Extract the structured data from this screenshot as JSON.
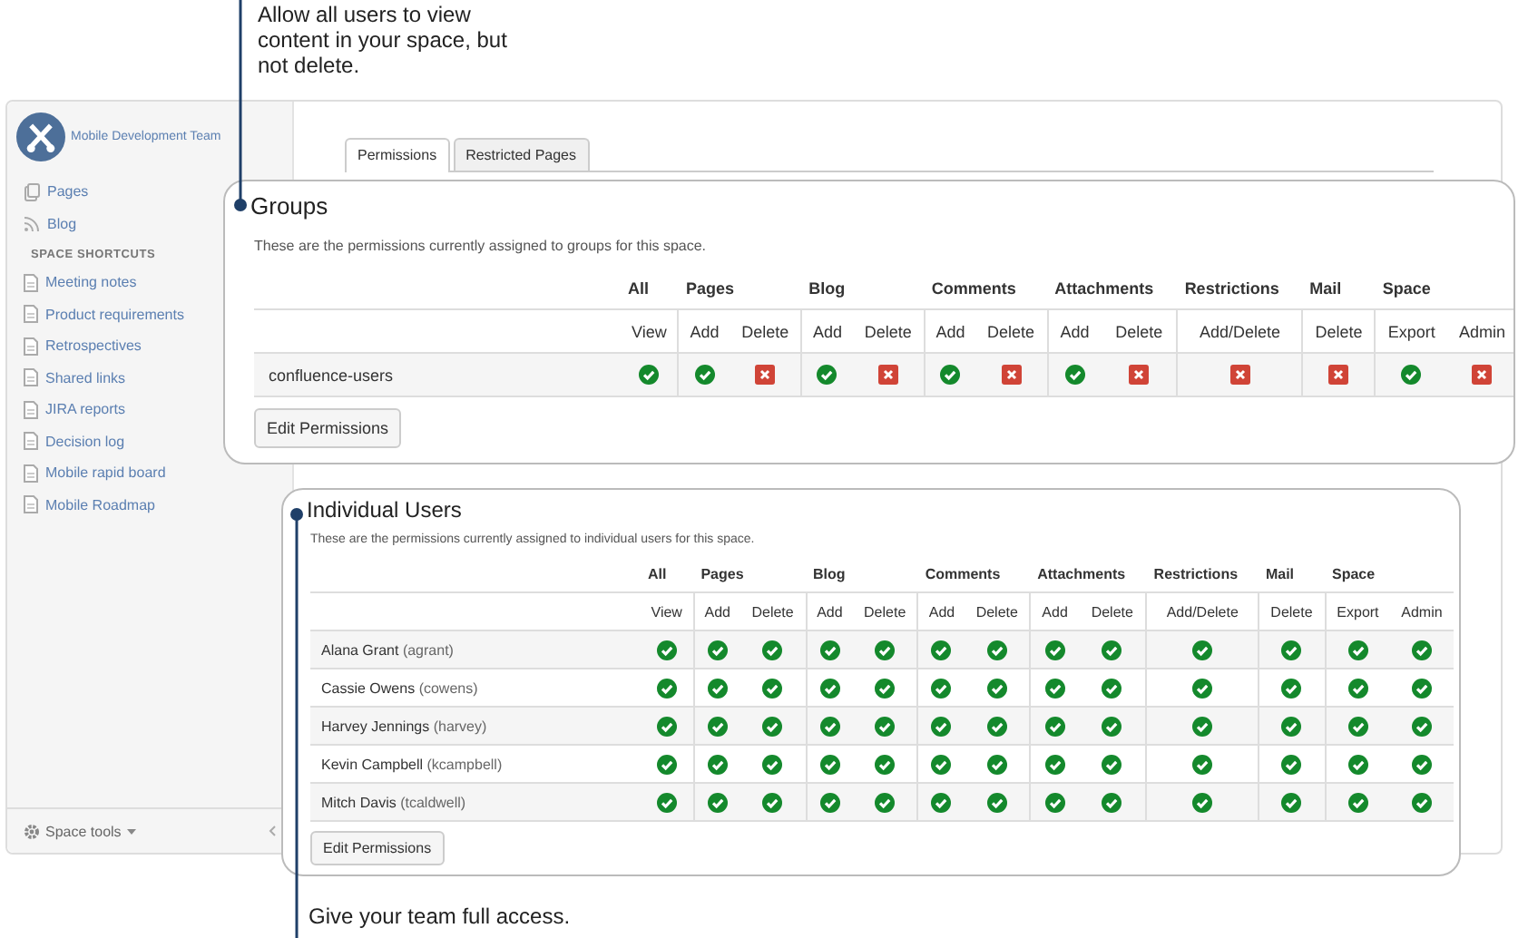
{
  "annotations": [
    {
      "text": "Allow all users to view content in your space, but not delete."
    },
    {
      "text": "Give your team full access."
    }
  ],
  "sidebar": {
    "space_name": "Mobile Development Team",
    "items": [
      {
        "label": "Pages",
        "kind": "pages"
      },
      {
        "label": "Blog",
        "kind": "blog"
      }
    ],
    "shortcuts_heading": "SPACE SHORTCUTS",
    "shortcuts": [
      {
        "label": "Meeting notes"
      },
      {
        "label": "Product requirements"
      },
      {
        "label": "Retrospectives"
      },
      {
        "label": "Shared links"
      },
      {
        "label": "JIRA reports"
      },
      {
        "label": "Decision log"
      },
      {
        "label": "Mobile rapid board"
      },
      {
        "label": "Mobile Roadmap"
      }
    ],
    "footer": "Space tools"
  },
  "tabs": [
    {
      "label": "Permissions",
      "selected": true
    },
    {
      "label": "Restricted Pages",
      "selected": false
    }
  ],
  "groups": {
    "title": "Groups",
    "description": "These are the permissions currently assigned to groups for this space.",
    "column_groups": [
      {
        "label": "All",
        "columns": [
          "View"
        ]
      },
      {
        "label": "Pages",
        "columns": [
          "Add",
          "Delete"
        ]
      },
      {
        "label": "Blog",
        "columns": [
          "Add",
          "Delete"
        ]
      },
      {
        "label": "Comments",
        "columns": [
          "Add",
          "Delete"
        ]
      },
      {
        "label": "Attachments",
        "columns": [
          "Add",
          "Delete"
        ]
      },
      {
        "label": "Restrictions",
        "columns": [
          "Add/Delete"
        ]
      },
      {
        "label": "Mail",
        "columns": [
          "Delete"
        ]
      },
      {
        "label": "Space",
        "columns": [
          "Export",
          "Admin"
        ]
      }
    ],
    "rows": [
      {
        "name": "confluence-users",
        "granted": [
          true,
          true,
          false,
          true,
          false,
          true,
          false,
          true,
          false,
          false,
          false,
          true,
          false
        ]
      }
    ],
    "button": "Edit Permissions"
  },
  "individual_users": {
    "title": "Individual Users",
    "description": "These are the permissions currently assigned to individual users for this space.",
    "column_groups": [
      {
        "label": "All",
        "columns": [
          "View"
        ]
      },
      {
        "label": "Pages",
        "columns": [
          "Add",
          "Delete"
        ]
      },
      {
        "label": "Blog",
        "columns": [
          "Add",
          "Delete"
        ]
      },
      {
        "label": "Comments",
        "columns": [
          "Add",
          "Delete"
        ]
      },
      {
        "label": "Attachments",
        "columns": [
          "Add",
          "Delete"
        ]
      },
      {
        "label": "Restrictions",
        "columns": [
          "Add/Delete"
        ]
      },
      {
        "label": "Mail",
        "columns": [
          "Delete"
        ]
      },
      {
        "label": "Space",
        "columns": [
          "Export",
          "Admin"
        ]
      }
    ],
    "rows": [
      {
        "name": "Alana Grant",
        "username": "(agrant)",
        "granted": [
          true,
          true,
          true,
          true,
          true,
          true,
          true,
          true,
          true,
          true,
          true,
          true,
          true
        ]
      },
      {
        "name": "Cassie Owens",
        "username": "(cowens)",
        "granted": [
          true,
          true,
          true,
          true,
          true,
          true,
          true,
          true,
          true,
          true,
          true,
          true,
          true
        ]
      },
      {
        "name": "Harvey Jennings",
        "username": "(harvey)",
        "granted": [
          true,
          true,
          true,
          true,
          true,
          true,
          true,
          true,
          true,
          true,
          true,
          true,
          true
        ]
      },
      {
        "name": "Kevin Campbell",
        "username": "(kcampbell)",
        "granted": [
          true,
          true,
          true,
          true,
          true,
          true,
          true,
          true,
          true,
          true,
          true,
          true,
          true
        ]
      },
      {
        "name": "Mitch Davis",
        "username": "(tcaldwell)",
        "granted": [
          true,
          true,
          true,
          true,
          true,
          true,
          true,
          true,
          true,
          true,
          true,
          true,
          true
        ]
      }
    ],
    "button": "Edit Permissions"
  }
}
